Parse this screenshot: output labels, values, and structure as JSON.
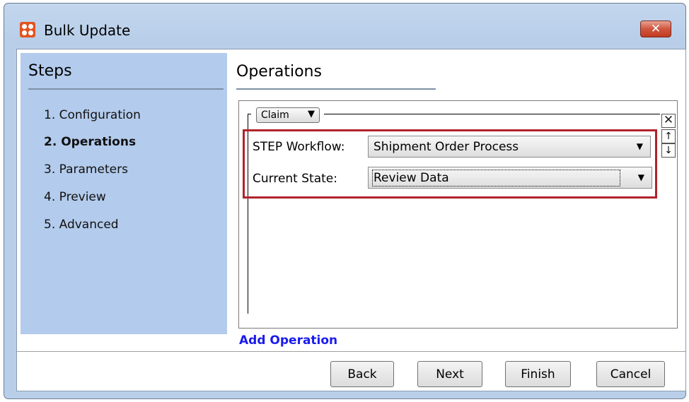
{
  "window": {
    "title": "Bulk Update",
    "close_label": "✕"
  },
  "sidebar": {
    "title": "Steps",
    "items": [
      {
        "label": "1. Configuration",
        "active": false
      },
      {
        "label": "2. Operations",
        "active": true
      },
      {
        "label": "3. Parameters",
        "active": false
      },
      {
        "label": "4. Preview",
        "active": false
      },
      {
        "label": "5. Advanced",
        "active": false
      }
    ]
  },
  "main": {
    "title": "Operations",
    "operation": {
      "type_selected": "Claim",
      "workflow_label": "STEP Workflow:",
      "workflow_value": "Shipment Order Process",
      "state_label": "Current State:",
      "state_value": "Review Data",
      "remove_glyph": "✕",
      "move_up_glyph": "↑",
      "move_down_glyph": "↓"
    },
    "add_operation_label": "Add Operation"
  },
  "footer": {
    "back_label": "Back",
    "next_label": "Next",
    "finish_label": "Finish",
    "cancel_label": "Cancel"
  },
  "colors": {
    "sidebar_bg": "#b3cbec",
    "highlight_border": "#b0232a",
    "link": "#1a1aee",
    "close_button": "#c23a22",
    "app_icon": "#e2541f"
  }
}
